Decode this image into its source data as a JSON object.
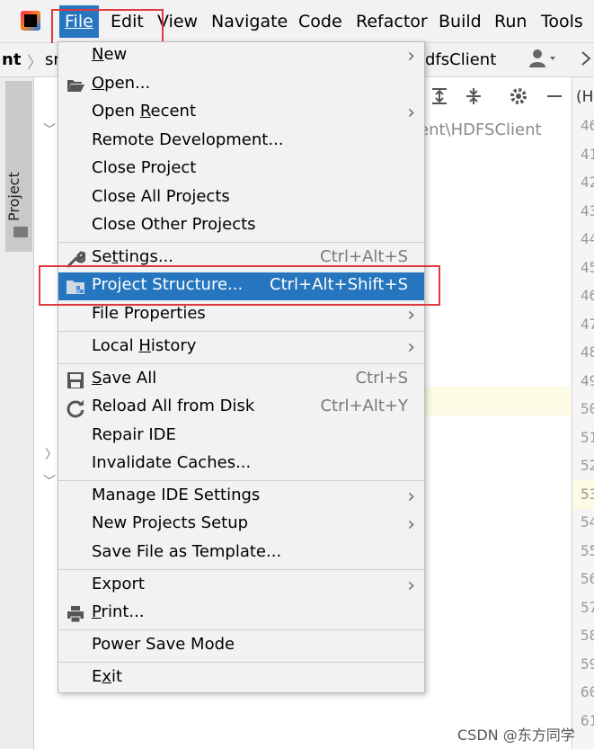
{
  "menubar": {
    "items": [
      "File",
      "Edit",
      "View",
      "Navigate",
      "Code",
      "Refactor",
      "Build",
      "Run",
      "Tools"
    ]
  },
  "breadcrumb": {
    "left_fragment": "nt",
    "src_fragment": "sr",
    "file_fragment": "dfsClient"
  },
  "editor": {
    "path_fragment": "ent\\HDFSClient",
    "tab_fragment": "(H",
    "line_numbers": [
      "46",
      "41",
      "42",
      "43",
      "44",
      "45",
      "46",
      "47",
      "48",
      "49",
      "50",
      "51",
      "52",
      "53",
      "54",
      "55",
      "56",
      "57",
      "58",
      "59",
      "60",
      "61"
    ]
  },
  "sidebar": {
    "project_tab": "Project"
  },
  "file_menu": {
    "items": [
      {
        "label": "New",
        "mnemonic": "N",
        "submenu": true
      },
      {
        "label": "Open...",
        "mnemonic": "O",
        "icon": "folder-open-icon"
      },
      {
        "label": "Open Recent",
        "mnemonic": "R",
        "submenu": true
      },
      {
        "label": "Remote Development..."
      },
      {
        "label": "Close Project"
      },
      {
        "label": "Close All Projects"
      },
      {
        "label": "Close Other Projects"
      },
      {
        "label": "Settings...",
        "mnemonic": "t",
        "icon": "wrench-icon",
        "shortcut": "Ctrl+Alt+S"
      },
      {
        "label": "Project Structure...",
        "icon": "project-structure-icon",
        "shortcut": "Ctrl+Alt+Shift+S",
        "selected": true
      },
      {
        "label": "File Properties",
        "submenu": true
      },
      {
        "label": "Local History",
        "mnemonic": "H",
        "submenu": true
      },
      {
        "label": "Save All",
        "mnemonic": "S",
        "icon": "save-icon",
        "shortcut": "Ctrl+S"
      },
      {
        "label": "Reload All from Disk",
        "icon": "reload-icon",
        "shortcut": "Ctrl+Alt+Y"
      },
      {
        "label": "Repair IDE"
      },
      {
        "label": "Invalidate Caches..."
      },
      {
        "label": "Manage IDE Settings",
        "submenu": true
      },
      {
        "label": "New Projects Setup",
        "submenu": true
      },
      {
        "label": "Save File as Template..."
      },
      {
        "label": "Export",
        "submenu": true
      },
      {
        "label": "Print...",
        "mnemonic": "P",
        "icon": "print-icon"
      },
      {
        "label": "Power Save Mode"
      },
      {
        "label": "Exit",
        "mnemonic": "x"
      }
    ]
  },
  "watermark": "CSDN @东方同学",
  "colors": {
    "selection": "#2675bf",
    "highlight_box": "#e0383e",
    "menu_background": "#f2f2f2"
  }
}
